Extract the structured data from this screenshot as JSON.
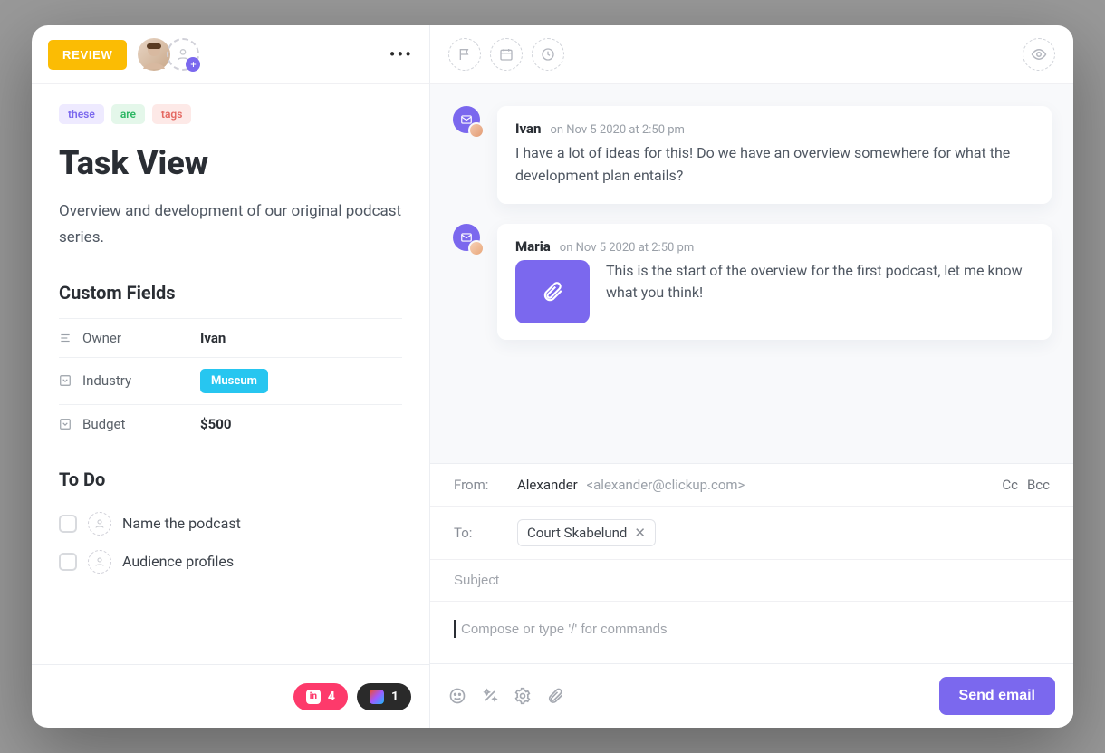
{
  "header": {
    "status_label": "REVIEW"
  },
  "tags": [
    "these",
    "are",
    "tags"
  ],
  "task": {
    "title": "Task View",
    "description": "Overview and development of our original podcast series."
  },
  "custom_fields": {
    "heading": "Custom Fields",
    "rows": [
      {
        "label": "Owner",
        "value": "Ivan"
      },
      {
        "label": "Industry",
        "value": "Museum"
      },
      {
        "label": "Budget",
        "value": "$500"
      }
    ]
  },
  "todo": {
    "heading": "To Do",
    "items": [
      {
        "label": "Name the podcast"
      },
      {
        "label": "Audience profiles"
      }
    ]
  },
  "attachments": {
    "invision_count": "4",
    "figma_count": "1"
  },
  "messages": [
    {
      "author": "Ivan",
      "timestamp": "on Nov 5 2020 at 2:50 pm",
      "body": "I have a lot of ideas for this! Do we have an overview somewhere for what the development plan entails?"
    },
    {
      "author": "Maria",
      "timestamp": "on Nov 5 2020 at 2:50 pm",
      "body": "This is the start of the overview for the first podcast, let me know what you think!",
      "has_attachment": true
    }
  ],
  "compose": {
    "from_label": "From:",
    "from_name": "Alexander",
    "from_email": "<alexander@clickup.com>",
    "cc_label": "Cc",
    "bcc_label": "Bcc",
    "to_label": "To:",
    "to_recipient": "Court Skabelund",
    "subject_placeholder": "Subject",
    "body_placeholder": "Compose or type '/' for commands",
    "send_label": "Send email"
  }
}
